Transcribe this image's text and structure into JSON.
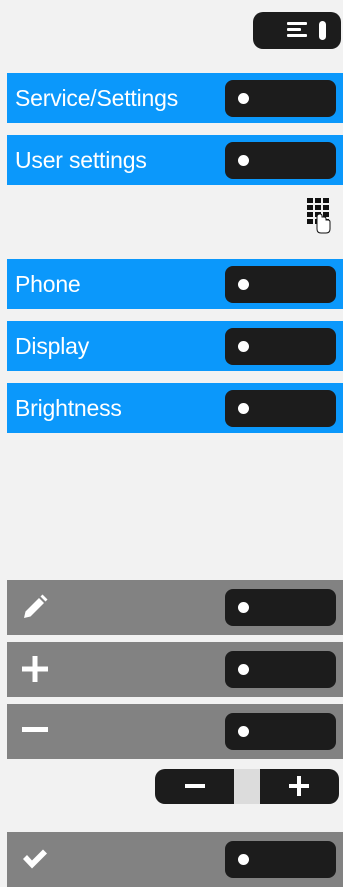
{
  "menu": [
    {
      "name": "service-settings",
      "label": "Service/Settings"
    },
    {
      "name": "user-settings",
      "label": "User settings"
    },
    {
      "name": "phone",
      "label": "Phone"
    },
    {
      "name": "display",
      "label": "Display"
    },
    {
      "name": "brightness",
      "label": "Brightness"
    }
  ],
  "actions": [
    {
      "name": "edit",
      "icon": "pencil-icon"
    },
    {
      "name": "increase",
      "icon": "plus-icon"
    },
    {
      "name": "decrease",
      "icon": "minus-icon"
    },
    {
      "name": "confirm",
      "icon": "checkmark-icon"
    }
  ],
  "colors": {
    "menu_row": "#0b98fb",
    "action_row": "#828282",
    "softkey": "#1c1c1c",
    "background": "#f2f2f2"
  }
}
